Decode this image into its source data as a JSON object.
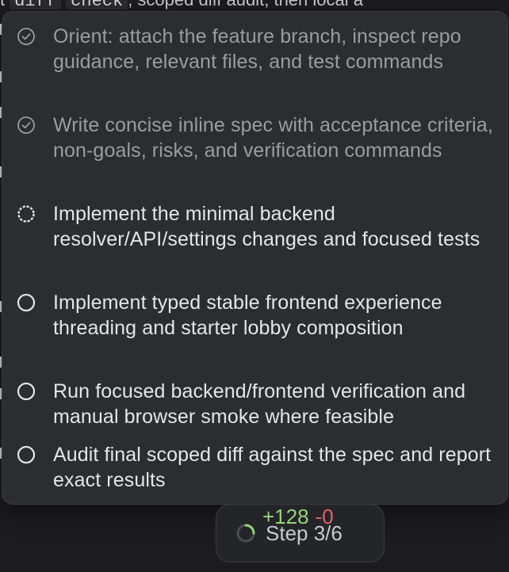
{
  "background": {
    "top_line_prefix": "t ",
    "top_line_code_1": "diff",
    "top_line_code_2": "check",
    "top_line_suffix": ", scoped diff audit, then local a"
  },
  "steps": [
    {
      "status": "done",
      "icon": "check-circle-icon",
      "text": "Orient: attach the feature branch, inspect repo guidance, relevant files, and test commands"
    },
    {
      "status": "done",
      "icon": "check-circle-icon",
      "text": "Write concise inline spec with acceptance criteria, non-goals, risks, and verification commands"
    },
    {
      "status": "active",
      "icon": "in-progress-circle-icon",
      "text": "Implement the minimal backend resolver/API/settings changes and focused tests"
    },
    {
      "status": "pending",
      "icon": "empty-circle-icon",
      "text": "Implement typed stable frontend experience threading and starter lobby composition"
    },
    {
      "status": "pending",
      "icon": "empty-circle-icon",
      "text": "Run focused backend/frontend verification and manual browser smoke where feasible"
    },
    {
      "status": "pending",
      "icon": "empty-circle-icon",
      "text": "Audit final scoped diff against the spec and report exact results"
    }
  ],
  "status_pill": {
    "step_label": "Step 3/6",
    "added": "+128",
    "removed": "-0",
    "icon": "spinner-icon"
  },
  "colors": {
    "popover_bg": "#2b2d30",
    "done_text": "#9a9ca1",
    "active_text": "#e4e5e8",
    "added": "#9bd37a",
    "removed": "#e0636b"
  }
}
